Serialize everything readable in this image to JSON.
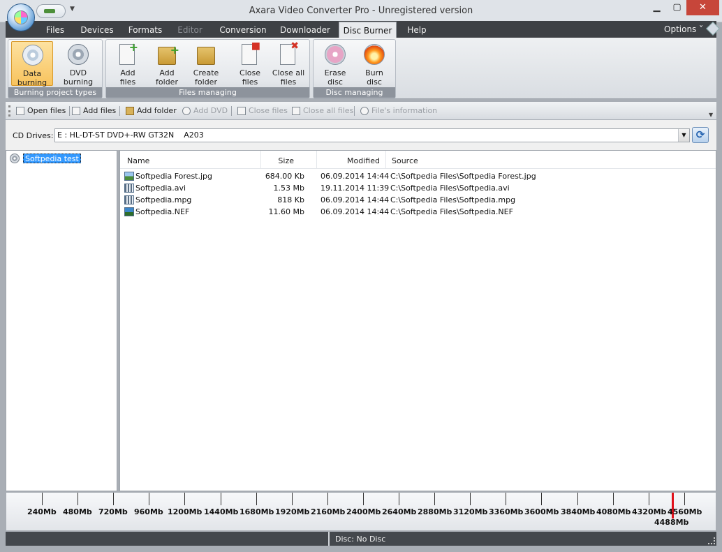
{
  "window": {
    "title": "Axara Video Converter Pro - Unregistered version",
    "min_icon": "minimize-icon",
    "max_icon": "maximize-icon",
    "close_icon": "close-icon"
  },
  "menu": {
    "tabs": [
      "Files",
      "Devices",
      "Formats",
      "Editor",
      "Conversion",
      "Downloader",
      "Disc Burner",
      "Help"
    ],
    "active_tab": "Disc Burner",
    "disabled_tab": "Editor",
    "options_label": "Options ˅"
  },
  "ribbon": {
    "groups": [
      {
        "label": "Burning project types",
        "buttons": [
          {
            "line1": "Data",
            "line2": "burning",
            "icon": "data-disc-icon",
            "active": true
          },
          {
            "line1": "DVD",
            "line2": "burning",
            "icon": "dvd-disc-icon"
          }
        ]
      },
      {
        "label": "Files managing",
        "buttons": [
          {
            "line1": "Add",
            "line2": "files",
            "icon": "add-files-icon"
          },
          {
            "line1": "Add",
            "line2": "folder",
            "icon": "add-folder-icon"
          },
          {
            "line1": "Create",
            "line2": "folder",
            "icon": "create-folder-icon"
          },
          {
            "line1": "Close",
            "line2": "files",
            "icon": "close-files-icon"
          },
          {
            "line1": "Close all",
            "line2": "files",
            "icon": "close-all-files-icon"
          }
        ]
      },
      {
        "label": "Disc managing",
        "buttons": [
          {
            "line1": "Erase",
            "line2": "disc",
            "icon": "erase-disc-icon"
          },
          {
            "line1": "Burn",
            "line2": "disc",
            "icon": "burn-disc-icon"
          }
        ]
      }
    ]
  },
  "toolbar": {
    "items": [
      {
        "label": "Open files",
        "icon": "open-files-icon",
        "enabled": true
      },
      {
        "label": "Add files",
        "icon": "add-files-icon",
        "enabled": true
      },
      {
        "label": "Add folder",
        "icon": "add-folder-icon",
        "enabled": true
      },
      {
        "label": "Add DVD",
        "icon": "add-dvd-icon",
        "enabled": false
      },
      {
        "label": "Close files",
        "icon": "close-files-icon",
        "enabled": false
      },
      {
        "label": "Close all files",
        "icon": "close-all-files-icon",
        "enabled": false
      },
      {
        "label": "File's information",
        "icon": "info-icon",
        "enabled": false
      }
    ]
  },
  "drives": {
    "label": "CD Drives:",
    "selected": "E : HL-DT-ST DVD+-RW GT32N    A203"
  },
  "tree": {
    "root_label": "Softpedia test"
  },
  "filelist": {
    "columns": [
      "Name",
      "Size",
      "Modified",
      "Source"
    ],
    "rows": [
      {
        "name": "Softpedia Forest.jpg",
        "size": "684.00 Kb",
        "modified": "06.09.2014 14:44",
        "source": "C:\\Softpedia Files\\Softpedia Forest.jpg",
        "icon": "image-file-icon"
      },
      {
        "name": "Softpedia.avi",
        "size": "1.53 Mb",
        "modified": "19.11.2014 11:39",
        "source": "C:\\Softpedia Files\\Softpedia.avi",
        "icon": "video-file-icon"
      },
      {
        "name": "Softpedia.mpg",
        "size": "818 Kb",
        "modified": "06.09.2014 14:44",
        "source": "C:\\Softpedia Files\\Softpedia.mpg",
        "icon": "video-file-icon"
      },
      {
        "name": "Softpedia.NEF",
        "size": "11.60 Mb",
        "modified": "06.09.2014 14:44",
        "source": "C:\\Softpedia Files\\Softpedia.NEF",
        "icon": "raw-image-file-icon"
      }
    ]
  },
  "scale": {
    "labels": [
      "240Mb",
      "480Mb",
      "720Mb",
      "960Mb",
      "1200Mb",
      "1440Mb",
      "1680Mb",
      "1920Mb",
      "2160Mb",
      "2400Mb",
      "2640Mb",
      "2880Mb",
      "3120Mb",
      "3360Mb",
      "3600Mb",
      "3840Mb",
      "4080Mb",
      "4320Mb",
      "4560Mb"
    ],
    "capacity_marker_label": "4488Mb"
  },
  "status": {
    "disc": "Disc: No Disc"
  }
}
